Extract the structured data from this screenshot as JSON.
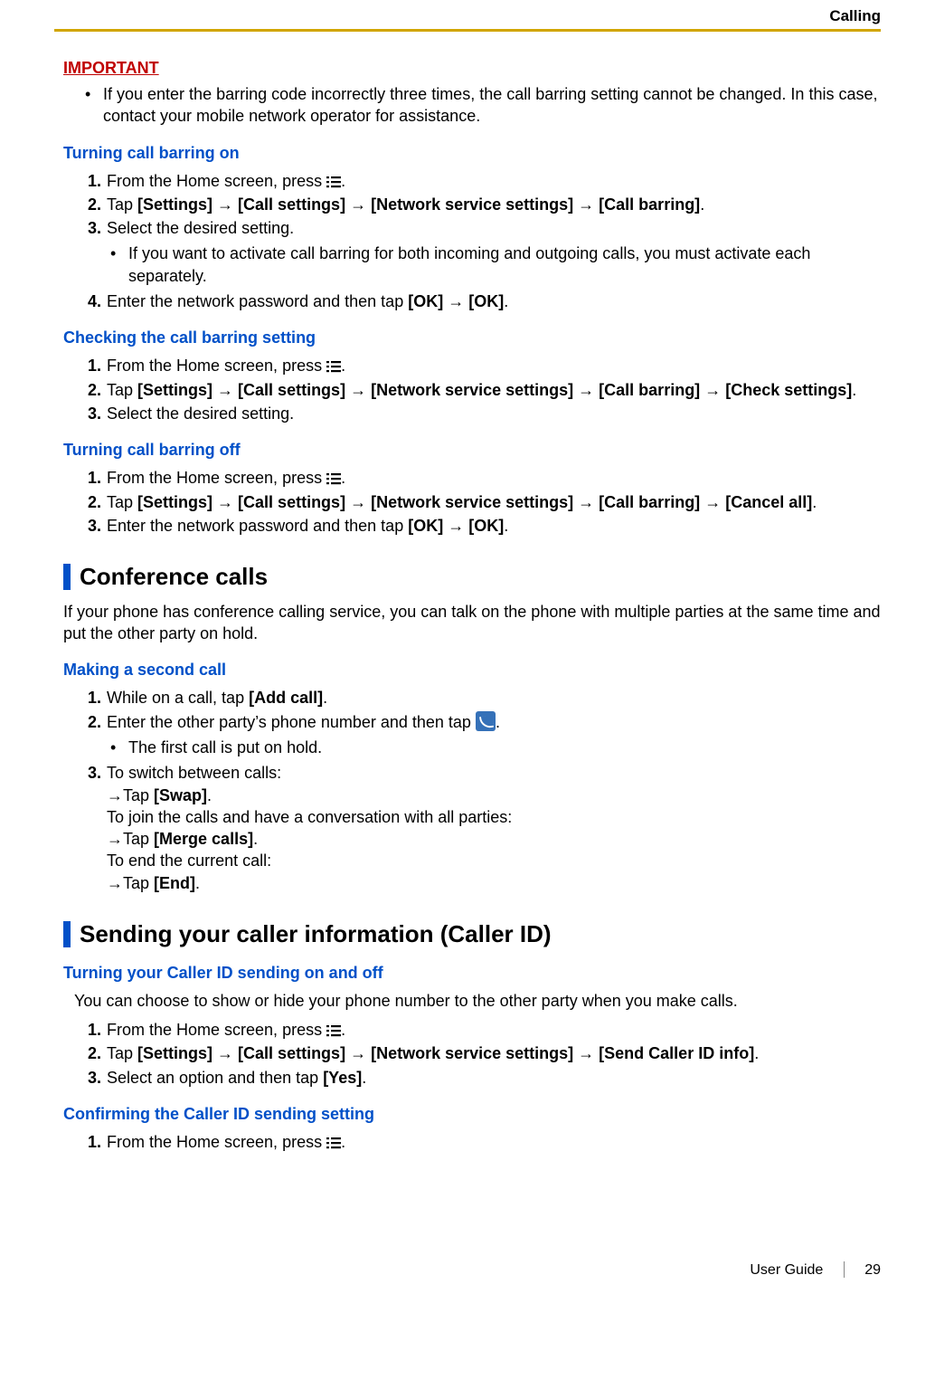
{
  "header": {
    "section": "Calling"
  },
  "important": {
    "label": "IMPORTANT",
    "bullet": "If you enter the barring code incorrectly three times, the call barring setting cannot be changed. In this case, contact your mobile network operator for assistance."
  },
  "barring_on": {
    "title": "Turning call barring on",
    "s1a": "From the Home screen, press ",
    "s1b": ".",
    "s2a": "Tap ",
    "s2_settings": "[Settings]",
    "s2_call": "[Call settings]",
    "s2_net": "[Network service settings]",
    "s2_barring": "[Call barring]",
    "s2b": ".",
    "s3": "Select the desired setting.",
    "s3_bullet": "If you want to activate call barring for both incoming and outgoing calls, you must activate each separately.",
    "s4a": "Enter the network password and then tap ",
    "s4_ok1": "[OK]",
    "s4_ok2": "[OK]",
    "s4b": "."
  },
  "barring_check": {
    "title": "Checking the call barring setting",
    "s1a": "From the Home screen, press ",
    "s1b": ".",
    "s2a": "Tap ",
    "s2_settings": "[Settings]",
    "s2_call": "[Call settings]",
    "s2_net": "[Network service settings]",
    "s2_barring": "[Call barring]",
    "s2_check": "[Check settings]",
    "s2b": ".",
    "s3": "Select the desired setting."
  },
  "barring_off": {
    "title": "Turning call barring off",
    "s1a": "From the Home screen, press ",
    "s1b": ".",
    "s2a": "Tap ",
    "s2_settings": "[Settings]",
    "s2_call": "[Call settings]",
    "s2_net": "[Network service settings]",
    "s2_barring": "[Call barring]",
    "s2_cancel": "[Cancel all]",
    "s2b": ".",
    "s3a": "Enter the network password and then tap ",
    "s3_ok1": "[OK]",
    "s3_ok2": "[OK]",
    "s3b": "."
  },
  "conf": {
    "title": "Conference calls",
    "intro": "If your phone has conference calling service, you can talk on the phone with multiple parties at the same time and put the other party on hold.",
    "sub": "Making a second call",
    "s1a": "While on a call, tap ",
    "s1_add": "[Add call]",
    "s1b": ".",
    "s2a": "Enter the other party’s phone number and then tap ",
    "s2b": ".",
    "s2_bullet": "The first call is put on hold.",
    "s3_intro": "To switch between calls:",
    "s3_swap_pre": "→Tap ",
    "s3_swap": "[Swap]",
    "s3_swap_post": ".",
    "s3_join_intro": "To join the calls and have a conversation with all parties:",
    "s3_merge_pre": "→Tap ",
    "s3_merge": "[Merge calls]",
    "s3_merge_post": ".",
    "s3_end_intro": "To end the current call:",
    "s3_end_pre": "→Tap ",
    "s3_end": "[End]",
    "s3_end_post": "."
  },
  "cid": {
    "title": "Sending your caller information (Caller ID)",
    "sub1": "Turning your Caller ID sending on and off",
    "intro": "You can choose to show or hide your phone number to the other party when you make calls.",
    "s1a": "From the Home screen, press ",
    "s1b": ".",
    "s2a": "Tap ",
    "s2_settings": "[Settings]",
    "s2_call": "[Call settings]",
    "s2_net": "[Network service settings]",
    "s2_send": "[Send Caller ID info]",
    "s2b": ".",
    "s3a": "Select an option and then tap ",
    "s3_yes": "[Yes]",
    "s3b": ".",
    "sub2": "Confirming the Caller ID sending setting",
    "c1a": "From the Home screen, press ",
    "c1b": "."
  },
  "footer": {
    "guide": "User Guide",
    "page": "29"
  },
  "arrow": " → "
}
